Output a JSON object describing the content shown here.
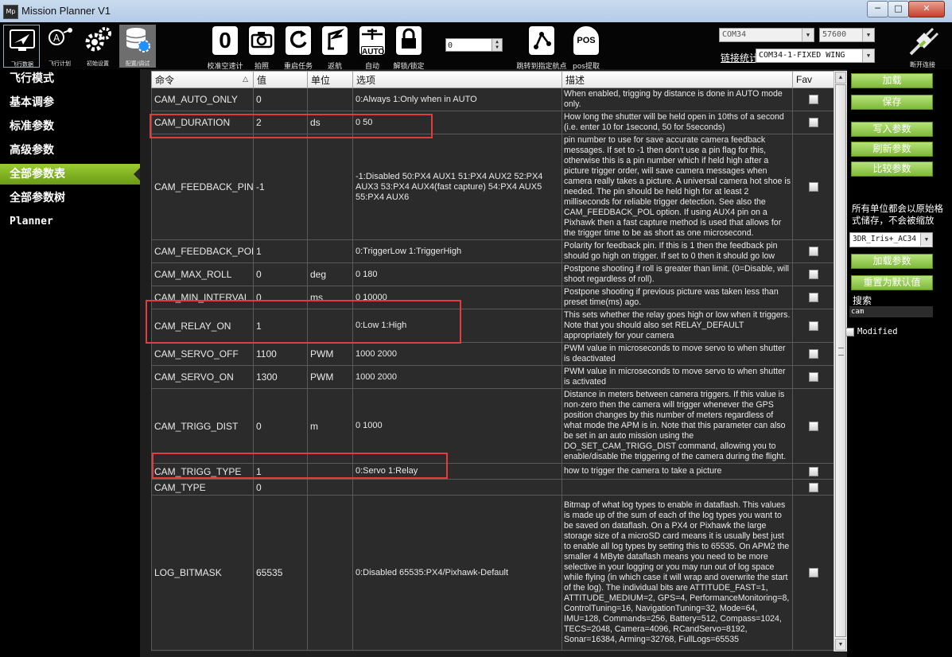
{
  "window": {
    "title": "Mission Planner V1",
    "icon_text": "Mp"
  },
  "nav_tabs": [
    {
      "label": "飞行数据",
      "icon": "plane-screen-icon"
    },
    {
      "label": "飞行计划",
      "icon": "map-pin-icon"
    },
    {
      "label": "初始设置",
      "icon": "gears-icon"
    },
    {
      "label": "配置/调试",
      "icon": "database-gear-icon"
    }
  ],
  "actions": [
    {
      "label": "校准空速计",
      "icon": "zero-icon",
      "glyph": "0"
    },
    {
      "label": "拍照",
      "icon": "camera-icon",
      "glyph": ""
    },
    {
      "label": "重启任务",
      "icon": "restart-icon",
      "glyph": ""
    },
    {
      "label": "返航",
      "icon": "return-home-icon",
      "glyph": ""
    },
    {
      "label": "自动",
      "icon": "auto-icon",
      "glyph": "AUTO"
    },
    {
      "label": "解锁/锁定",
      "icon": "lock-icon",
      "glyph": ""
    }
  ],
  "waypoint_spinner_value": "0",
  "goto_waypoint_label": "跳转到指定航点",
  "pos_label": "pos提取",
  "pos_glyph": "POS",
  "connection": {
    "port": "COM34",
    "baud": "57600",
    "link_label": "链接统计",
    "link_value": "COM34-1-FIXED WING",
    "disconnect_label": "断开连接"
  },
  "left_nav": [
    {
      "label": "飞行模式",
      "active": false
    },
    {
      "label": "基本调参",
      "active": false
    },
    {
      "label": "标准参数",
      "active": false
    },
    {
      "label": "高级参数",
      "active": false
    },
    {
      "label": "全部参数表",
      "active": true
    },
    {
      "label": "全部参数树",
      "active": false
    },
    {
      "label": "Planner",
      "active": false
    }
  ],
  "table": {
    "headers": [
      "命令",
      "值",
      "单位",
      "选项",
      "描述",
      "Fav"
    ],
    "rows": [
      {
        "name": "CAM_AUTO_ONLY",
        "value": "0",
        "unit": "",
        "options": "0:Always 1:Only when in AUTO",
        "desc": "When enabled, trigging by distance is done in AUTO mode only."
      },
      {
        "name": "CAM_DURATION",
        "value": "2",
        "unit": "ds",
        "options": "0 50",
        "desc": "How long the shutter will be held open in 10ths of a second (i.e. enter 10 for 1second, 50 for 5seconds)"
      },
      {
        "name": "CAM_FEEDBACK_PIN",
        "value": "-1",
        "unit": "",
        "options": "-1:Disabled 50:PX4 AUX1 51:PX4 AUX2 52:PX4 AUX3 53:PX4 AUX4(fast capture) 54:PX4 AUX5 55:PX4 AUX6",
        "desc": "pin number to use for save accurate camera feedback messages. If set to -1 then don't use a pin flag for this, otherwise this is a pin number which if held high after a picture trigger order, will save camera messages when camera really takes a picture. A universal camera hot shoe is needed. The pin should be held high for at least 2 milliseconds for reliable trigger detection. See also the CAM_FEEDBACK_POL option. If using AUX4 pin on a Pixhawk then a fast capture method is used that allows for the trigger time to be as short as one microsecond."
      },
      {
        "name": "CAM_FEEDBACK_POL",
        "value": "1",
        "unit": "",
        "options": "0:TriggerLow 1:TriggerHigh",
        "desc": "Polarity for feedback pin. If this is 1 then the feedback pin should go high on trigger. If set to 0 then it should go low"
      },
      {
        "name": "CAM_MAX_ROLL",
        "value": "0",
        "unit": "deg",
        "options": "0 180",
        "desc": "Postpone shooting if roll is greater than limit. (0=Disable, will shoot regardless of roll)."
      },
      {
        "name": "CAM_MIN_INTERVAL",
        "value": "0",
        "unit": "ms",
        "options": "0 10000",
        "desc": "Postpone shooting if previous picture was taken less than preset time(ms) ago."
      },
      {
        "name": "CAM_RELAY_ON",
        "value": "1",
        "unit": "",
        "options": "0:Low 1:High",
        "desc": "This sets whether the relay goes high or low when it triggers. Note that you should also set RELAY_DEFAULT appropriately for your camera"
      },
      {
        "name": "CAM_SERVO_OFF",
        "value": "1100",
        "unit": "PWM",
        "options": "1000 2000",
        "desc": "PWM value in microseconds to move servo to when shutter is deactivated"
      },
      {
        "name": "CAM_SERVO_ON",
        "value": "1300",
        "unit": "PWM",
        "options": "1000 2000",
        "desc": "PWM value in microseconds to move servo to when shutter is activated"
      },
      {
        "name": "CAM_TRIGG_DIST",
        "value": "0",
        "unit": "m",
        "options": "0 1000",
        "desc": "Distance in meters between camera triggers. If this value is non-zero then the camera will trigger whenever the GPS position changes by this number of meters regardless of what mode the APM is in. Note that this parameter can also be set in an auto mission using the DO_SET_CAM_TRIGG_DIST command, allowing you to enable/disable the triggering of the camera during the flight."
      },
      {
        "name": "CAM_TRIGG_TYPE",
        "value": "1",
        "unit": "",
        "options": "0:Servo 1:Relay",
        "desc": "how to trigger the camera to take a picture"
      },
      {
        "name": "CAM_TYPE",
        "value": "0",
        "unit": "",
        "options": "",
        "desc": ""
      },
      {
        "name": "LOG_BITMASK",
        "value": "65535",
        "unit": "",
        "options": "0:Disabled 65535:PX4/Pixhawk-Default",
        "desc": "Bitmap of what log types to enable in dataflash. This values is made up of the sum of each of the log types you want to be saved on dataflash. On a PX4 or Pixhawk the large storage size of a microSD card means it is usually best just to enable all log types by setting this to 65535. On APM2 the smaller 4 MByte dataflash means you need to be more selective in your logging or you may run out of log space while flying (in which case it will wrap and overwrite the start of the log). The individual bits are ATTITUDE_FAST=1, ATTITUDE_MEDIUM=2, GPS=4, PerformanceMonitoring=8, ControlTuning=16, NavigationTuning=32, Mode=64, IMU=128, Commands=256, Battery=512, Compass=1024, TECS=2048, Camera=4096, RCandServo=8192, Sonar=16384, Arming=32768, FullLogs=65535"
      }
    ]
  },
  "right_panel": {
    "load_label": "加载",
    "save_label": "保存",
    "write_label": "写入参数",
    "refresh_label": "刷新参数",
    "compare_label": "比较参数",
    "note": "所有单位都会以原始格式储存，不会被缩放",
    "preset_value": "3DR_Iris+_AC34",
    "load_params_label": "加载参数",
    "reset_default_label": "重置为默认值",
    "search_label": "搜索",
    "search_value": "cam",
    "modified_label": "Modified"
  },
  "colors": {
    "accent_green": "#9acd32",
    "highlight_red": "#e23c3c",
    "background": "#000000"
  }
}
